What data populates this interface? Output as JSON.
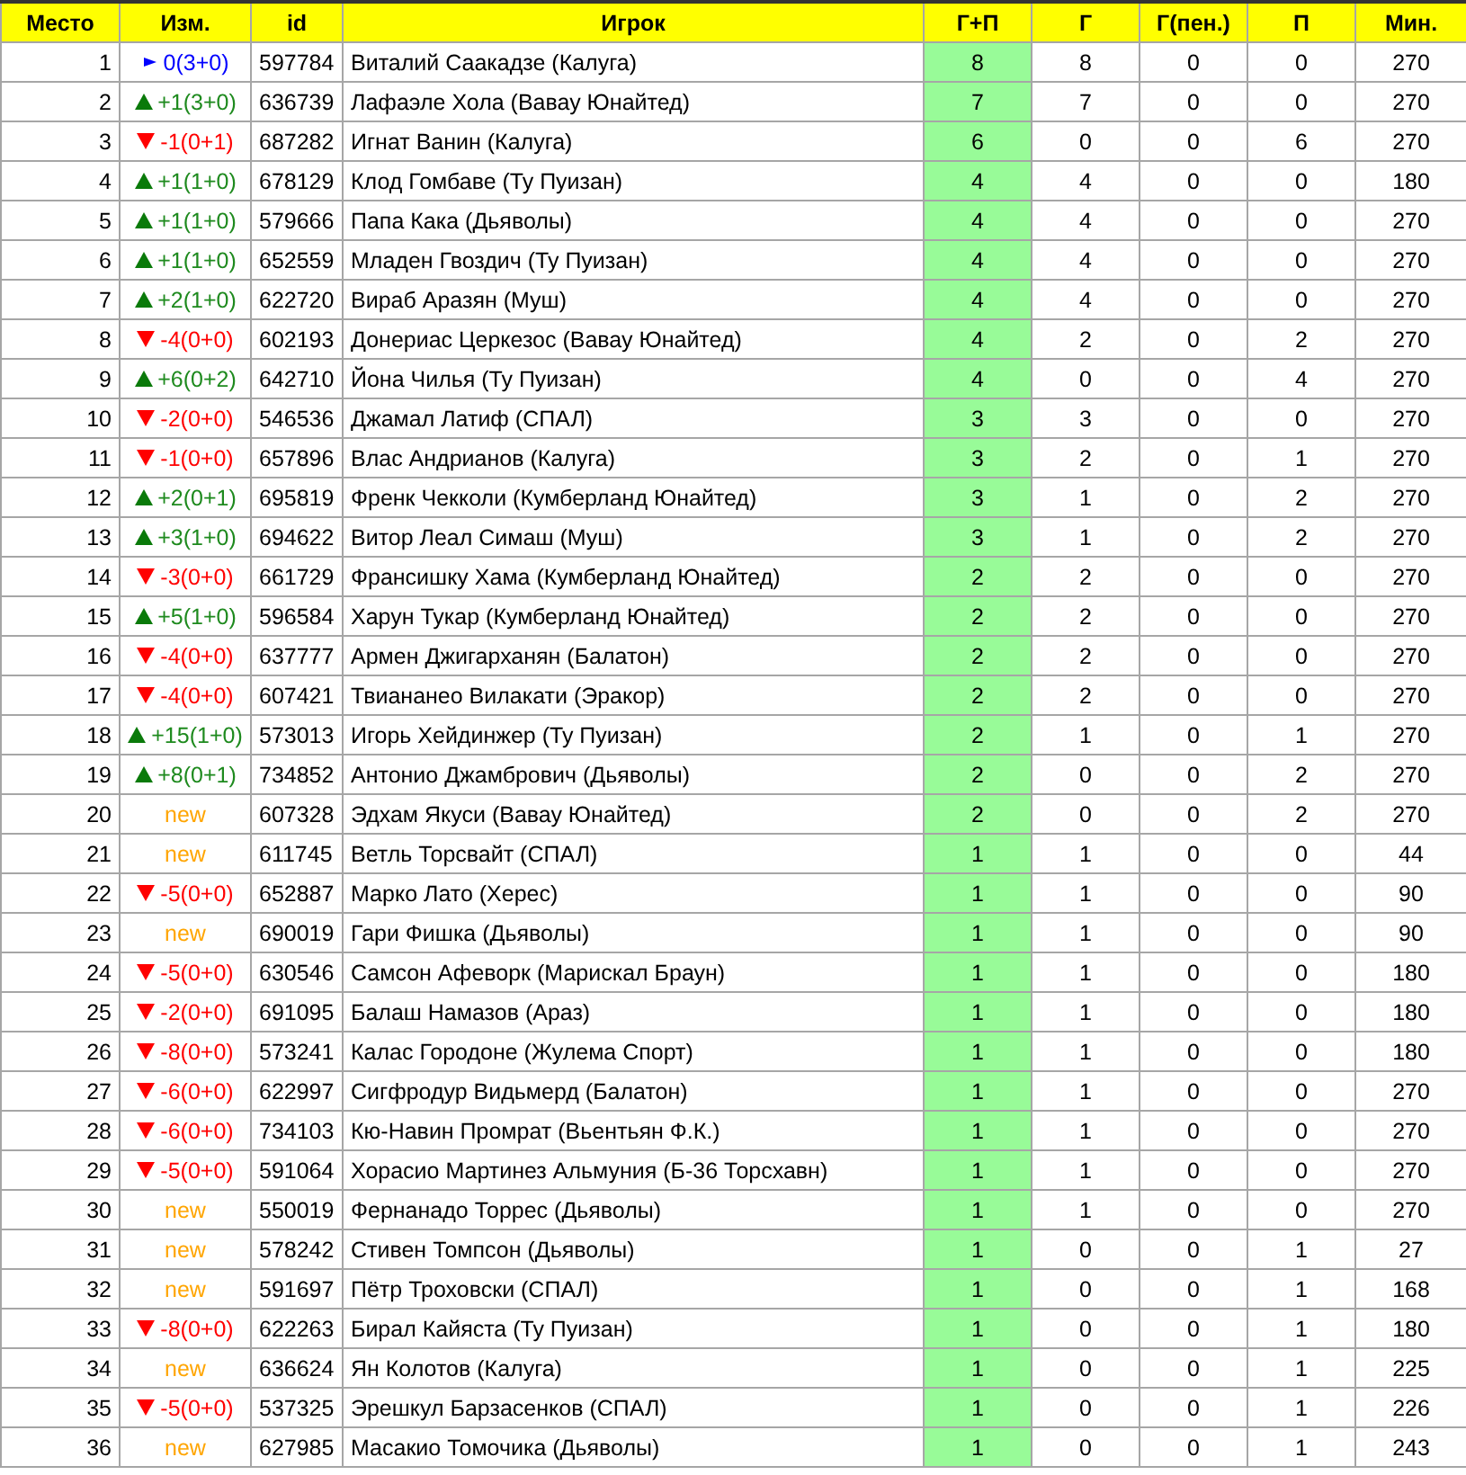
{
  "table": {
    "columns": [
      "Место",
      "Изм.",
      "id",
      "Игрок",
      "Г+П",
      "Г",
      "Г(пен.)",
      "П",
      "Мин."
    ],
    "rows": [
      {
        "place": "1",
        "change": {
          "kind": "same",
          "text": "0(3+0)"
        },
        "id": "597784",
        "player": "Виталий Саакадзе (Калуга)",
        "goals_assists": "8",
        "goals": "8",
        "penalty_goals": "0",
        "assists": "0",
        "minutes": "270"
      },
      {
        "place": "2",
        "change": {
          "kind": "up",
          "text": "+1(3+0)"
        },
        "id": "636739",
        "player": "Лафаэле Хола (Вавау Юнайтед)",
        "goals_assists": "7",
        "goals": "7",
        "penalty_goals": "0",
        "assists": "0",
        "minutes": "270"
      },
      {
        "place": "3",
        "change": {
          "kind": "down",
          "text": "-1(0+1)"
        },
        "id": "687282",
        "player": "Игнат Ванин (Калуга)",
        "goals_assists": "6",
        "goals": "0",
        "penalty_goals": "0",
        "assists": "6",
        "minutes": "270"
      },
      {
        "place": "4",
        "change": {
          "kind": "up",
          "text": "+1(1+0)"
        },
        "id": "678129",
        "player": "Клод Гомбаве (Ту Пуизан)",
        "goals_assists": "4",
        "goals": "4",
        "penalty_goals": "0",
        "assists": "0",
        "minutes": "180"
      },
      {
        "place": "5",
        "change": {
          "kind": "up",
          "text": "+1(1+0)"
        },
        "id": "579666",
        "player": "Папа Кака (Дьяволы)",
        "goals_assists": "4",
        "goals": "4",
        "penalty_goals": "0",
        "assists": "0",
        "minutes": "270"
      },
      {
        "place": "6",
        "change": {
          "kind": "up",
          "text": "+1(1+0)"
        },
        "id": "652559",
        "player": "Младен Гвоздич (Ту Пуизан)",
        "goals_assists": "4",
        "goals": "4",
        "penalty_goals": "0",
        "assists": "0",
        "minutes": "270"
      },
      {
        "place": "7",
        "change": {
          "kind": "up",
          "text": "+2(1+0)"
        },
        "id": "622720",
        "player": "Вираб Аразян (Муш)",
        "goals_assists": "4",
        "goals": "4",
        "penalty_goals": "0",
        "assists": "0",
        "minutes": "270"
      },
      {
        "place": "8",
        "change": {
          "kind": "down",
          "text": "-4(0+0)"
        },
        "id": "602193",
        "player": "Донериас Церкезос (Вавау Юнайтед)",
        "goals_assists": "4",
        "goals": "2",
        "penalty_goals": "0",
        "assists": "2",
        "minutes": "270"
      },
      {
        "place": "9",
        "change": {
          "kind": "up",
          "text": "+6(0+2)"
        },
        "id": "642710",
        "player": "Йона Чилья (Ту Пуизан)",
        "goals_assists": "4",
        "goals": "0",
        "penalty_goals": "0",
        "assists": "4",
        "minutes": "270"
      },
      {
        "place": "10",
        "change": {
          "kind": "down",
          "text": "-2(0+0)"
        },
        "id": "546536",
        "player": "Джамал Латиф (СПАЛ)",
        "goals_assists": "3",
        "goals": "3",
        "penalty_goals": "0",
        "assists": "0",
        "minutes": "270"
      },
      {
        "place": "11",
        "change": {
          "kind": "down",
          "text": "-1(0+0)"
        },
        "id": "657896",
        "player": "Влас Андрианов (Калуга)",
        "goals_assists": "3",
        "goals": "2",
        "penalty_goals": "0",
        "assists": "1",
        "minutes": "270"
      },
      {
        "place": "12",
        "change": {
          "kind": "up",
          "text": "+2(0+1)"
        },
        "id": "695819",
        "player": "Френк Чекколи (Кумберланд Юнайтед)",
        "goals_assists": "3",
        "goals": "1",
        "penalty_goals": "0",
        "assists": "2",
        "minutes": "270"
      },
      {
        "place": "13",
        "change": {
          "kind": "up",
          "text": "+3(1+0)"
        },
        "id": "694622",
        "player": "Витор Леал Симаш (Муш)",
        "goals_assists": "3",
        "goals": "1",
        "penalty_goals": "0",
        "assists": "2",
        "minutes": "270"
      },
      {
        "place": "14",
        "change": {
          "kind": "down",
          "text": "-3(0+0)"
        },
        "id": "661729",
        "player": "Франсишку Хама (Кумберланд Юнайтед)",
        "goals_assists": "2",
        "goals": "2",
        "penalty_goals": "0",
        "assists": "0",
        "minutes": "270"
      },
      {
        "place": "15",
        "change": {
          "kind": "up",
          "text": "+5(1+0)"
        },
        "id": "596584",
        "player": "Харун Тукар (Кумберланд Юнайтед)",
        "goals_assists": "2",
        "goals": "2",
        "penalty_goals": "0",
        "assists": "0",
        "minutes": "270"
      },
      {
        "place": "16",
        "change": {
          "kind": "down",
          "text": "-4(0+0)"
        },
        "id": "637777",
        "player": "Армен Джигарханян (Балатон)",
        "goals_assists": "2",
        "goals": "2",
        "penalty_goals": "0",
        "assists": "0",
        "minutes": "270"
      },
      {
        "place": "17",
        "change": {
          "kind": "down",
          "text": "-4(0+0)"
        },
        "id": "607421",
        "player": "Твиананео Вилакати (Эракор)",
        "goals_assists": "2",
        "goals": "2",
        "penalty_goals": "0",
        "assists": "0",
        "minutes": "270"
      },
      {
        "place": "18",
        "change": {
          "kind": "up",
          "text": "+15(1+0)"
        },
        "id": "573013",
        "player": "Игорь Хейдинжер (Ту Пуизан)",
        "goals_assists": "2",
        "goals": "1",
        "penalty_goals": "0",
        "assists": "1",
        "minutes": "270"
      },
      {
        "place": "19",
        "change": {
          "kind": "up",
          "text": "+8(0+1)"
        },
        "id": "734852",
        "player": "Антонио Джамбрович (Дьяволы)",
        "goals_assists": "2",
        "goals": "0",
        "penalty_goals": "0",
        "assists": "2",
        "minutes": "270"
      },
      {
        "place": "20",
        "change": {
          "kind": "new",
          "text": "new"
        },
        "id": "607328",
        "player": "Эдхам Якуси (Вавау Юнайтед)",
        "goals_assists": "2",
        "goals": "0",
        "penalty_goals": "0",
        "assists": "2",
        "minutes": "270"
      },
      {
        "place": "21",
        "change": {
          "kind": "new",
          "text": "new"
        },
        "id": "611745",
        "player": "Ветль Торсвайт (СПАЛ)",
        "goals_assists": "1",
        "goals": "1",
        "penalty_goals": "0",
        "assists": "0",
        "minutes": "44"
      },
      {
        "place": "22",
        "change": {
          "kind": "down",
          "text": "-5(0+0)"
        },
        "id": "652887",
        "player": "Марко Лато (Херес)",
        "goals_assists": "1",
        "goals": "1",
        "penalty_goals": "0",
        "assists": "0",
        "minutes": "90"
      },
      {
        "place": "23",
        "change": {
          "kind": "new",
          "text": "new"
        },
        "id": "690019",
        "player": "Гари Фишка (Дьяволы)",
        "goals_assists": "1",
        "goals": "1",
        "penalty_goals": "0",
        "assists": "0",
        "minutes": "90"
      },
      {
        "place": "24",
        "change": {
          "kind": "down",
          "text": "-5(0+0)"
        },
        "id": "630546",
        "player": "Самсон Афеворк (Марискал Браун)",
        "goals_assists": "1",
        "goals": "1",
        "penalty_goals": "0",
        "assists": "0",
        "minutes": "180"
      },
      {
        "place": "25",
        "change": {
          "kind": "down",
          "text": "-2(0+0)"
        },
        "id": "691095",
        "player": "Балаш Намазов (Араз)",
        "goals_assists": "1",
        "goals": "1",
        "penalty_goals": "0",
        "assists": "0",
        "minutes": "180"
      },
      {
        "place": "26",
        "change": {
          "kind": "down",
          "text": "-8(0+0)"
        },
        "id": "573241",
        "player": "Калас Городоне (Жулема Спорт)",
        "goals_assists": "1",
        "goals": "1",
        "penalty_goals": "0",
        "assists": "0",
        "minutes": "180"
      },
      {
        "place": "27",
        "change": {
          "kind": "down",
          "text": "-6(0+0)"
        },
        "id": "622997",
        "player": "Сигфродур Видьмерд (Балатон)",
        "goals_assists": "1",
        "goals": "1",
        "penalty_goals": "0",
        "assists": "0",
        "minutes": "270"
      },
      {
        "place": "28",
        "change": {
          "kind": "down",
          "text": "-6(0+0)"
        },
        "id": "734103",
        "player": "Кю-Навин Промрат (Вьентьян Ф.К.)",
        "goals_assists": "1",
        "goals": "1",
        "penalty_goals": "0",
        "assists": "0",
        "minutes": "270"
      },
      {
        "place": "29",
        "change": {
          "kind": "down",
          "text": "-5(0+0)"
        },
        "id": "591064",
        "player": "Хорасио Мартинез Альмуния (Б-36 Торсхавн)",
        "goals_assists": "1",
        "goals": "1",
        "penalty_goals": "0",
        "assists": "0",
        "minutes": "270"
      },
      {
        "place": "30",
        "change": {
          "kind": "new",
          "text": "new"
        },
        "id": "550019",
        "player": "Фернанадо Торрес (Дьяволы)",
        "goals_assists": "1",
        "goals": "1",
        "penalty_goals": "0",
        "assists": "0",
        "minutes": "270"
      },
      {
        "place": "31",
        "change": {
          "kind": "new",
          "text": "new"
        },
        "id": "578242",
        "player": "Стивен Томпсон (Дьяволы)",
        "goals_assists": "1",
        "goals": "0",
        "penalty_goals": "0",
        "assists": "1",
        "minutes": "27"
      },
      {
        "place": "32",
        "change": {
          "kind": "new",
          "text": "new"
        },
        "id": "591697",
        "player": "Пётр Троховски (СПАЛ)",
        "goals_assists": "1",
        "goals": "0",
        "penalty_goals": "0",
        "assists": "1",
        "minutes": "168"
      },
      {
        "place": "33",
        "change": {
          "kind": "down",
          "text": "-8(0+0)"
        },
        "id": "622263",
        "player": "Бирал Кайяста (Ту Пуизан)",
        "goals_assists": "1",
        "goals": "0",
        "penalty_goals": "0",
        "assists": "1",
        "minutes": "180"
      },
      {
        "place": "34",
        "change": {
          "kind": "new",
          "text": "new"
        },
        "id": "636624",
        "player": "Ян Колотов (Калуга)",
        "goals_assists": "1",
        "goals": "0",
        "penalty_goals": "0",
        "assists": "1",
        "minutes": "225"
      },
      {
        "place": "35",
        "change": {
          "kind": "down",
          "text": "-5(0+0)"
        },
        "id": "537325",
        "player": "Эрешкул Барзасенков (СПАЛ)",
        "goals_assists": "1",
        "goals": "0",
        "penalty_goals": "0",
        "assists": "1",
        "minutes": "226"
      },
      {
        "place": "36",
        "change": {
          "kind": "new",
          "text": "new"
        },
        "id": "627985",
        "player": "Масакио Томочика (Дьяволы)",
        "goals_assists": "1",
        "goals": "0",
        "penalty_goals": "0",
        "assists": "1",
        "minutes": "243"
      }
    ]
  }
}
